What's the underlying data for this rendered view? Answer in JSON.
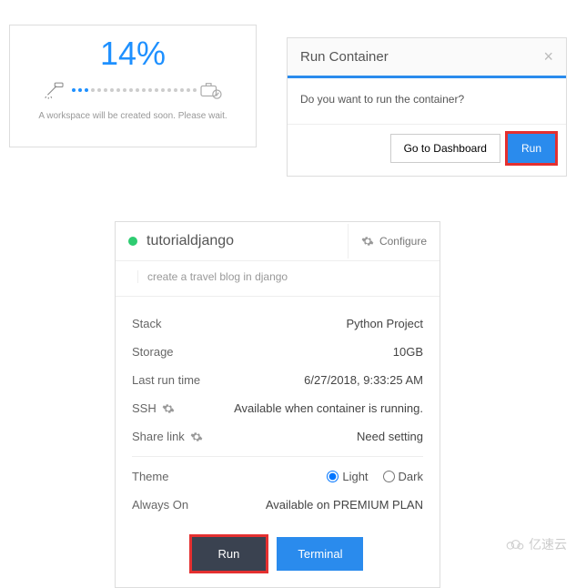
{
  "progress": {
    "percent": "14%",
    "message": "A workspace will be created soon. Please wait."
  },
  "modal": {
    "title": "Run Container",
    "body": "Do you want to run the container?",
    "go_dashboard": "Go to Dashboard",
    "run": "Run"
  },
  "panel": {
    "title": "tutorialdjango",
    "configure": "Configure",
    "description": "create a travel blog in django",
    "rows": {
      "stack": {
        "label": "Stack",
        "value": "Python Project"
      },
      "storage": {
        "label": "Storage",
        "value": "10GB"
      },
      "last_run": {
        "label": "Last run time",
        "value": "6/27/2018, 9:33:25 AM"
      },
      "ssh": {
        "label": "SSH",
        "value": "Available when container is running."
      },
      "share": {
        "label": "Share link",
        "value": "Need setting"
      },
      "theme": {
        "label": "Theme",
        "light": "Light",
        "dark": "Dark"
      },
      "always_on": {
        "label": "Always On",
        "value": "Available on PREMIUM PLAN"
      }
    },
    "actions": {
      "run": "Run",
      "terminal": "Terminal"
    }
  },
  "watermark": "亿速云"
}
